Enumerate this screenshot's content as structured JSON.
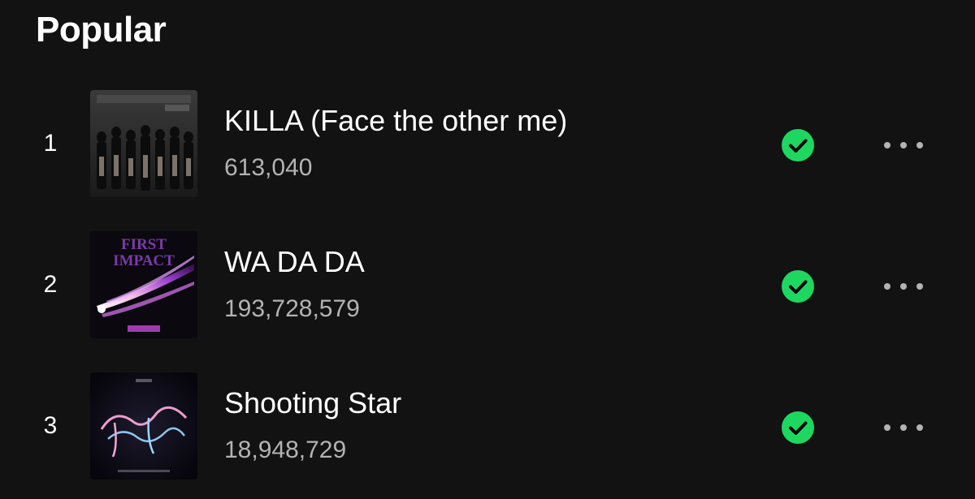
{
  "section": {
    "title": "Popular"
  },
  "colors": {
    "background": "#121212",
    "accent_green": "#1ed760",
    "secondary_text": "#b3b3b3"
  },
  "tracks": [
    {
      "rank": "1",
      "title": "KILLA (Face the other me)",
      "plays": "613,040",
      "saved": true,
      "cover_text": ""
    },
    {
      "rank": "2",
      "title": "WA DA DA",
      "plays": "193,728,579",
      "saved": true,
      "cover_text": "FIRST IMPACT"
    },
    {
      "rank": "3",
      "title": "Shooting Star",
      "plays": "18,948,729",
      "saved": true,
      "cover_text": ""
    }
  ],
  "icons": {
    "saved": "check-circle-icon",
    "more": "more-options-icon"
  }
}
